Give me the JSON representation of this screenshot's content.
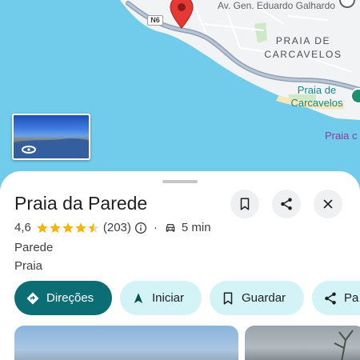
{
  "map": {
    "street_label": "Av. Gen. Eduardo Galhardo",
    "road_shield": "N6",
    "district_label_line1": "PRAIA DE",
    "district_label_line2": "CARCAVELOS",
    "beach_label_line1": "Praia de",
    "beach_label_line2": "Carcavelos",
    "cut_label": "Praia c",
    "colors": {
      "water": "#71ccec",
      "land": "#f1f3f4",
      "road": "#8ea1b6",
      "pin": "#e53935"
    }
  },
  "place": {
    "title": "Praia da Parede",
    "rating": "4,6",
    "stars_filled": 4.5,
    "reviews": "(203)",
    "separator": "·",
    "drive_time": "5 min",
    "locality": "Parede",
    "category": "Praia"
  },
  "actions": {
    "directions": "Direções",
    "start": "Iniciar",
    "save": "Guardar",
    "share": "Pa"
  },
  "icons": {
    "save": "bookmark-icon",
    "share": "share-icon",
    "close": "close-icon",
    "info": "info-icon",
    "car": "car-icon",
    "directions": "directions-icon",
    "navigate": "navigation-arrow-icon"
  },
  "colors": {
    "primary_button": "#0b6e74",
    "chip_bg": "#d3f3f7",
    "star": "#f5b400"
  }
}
